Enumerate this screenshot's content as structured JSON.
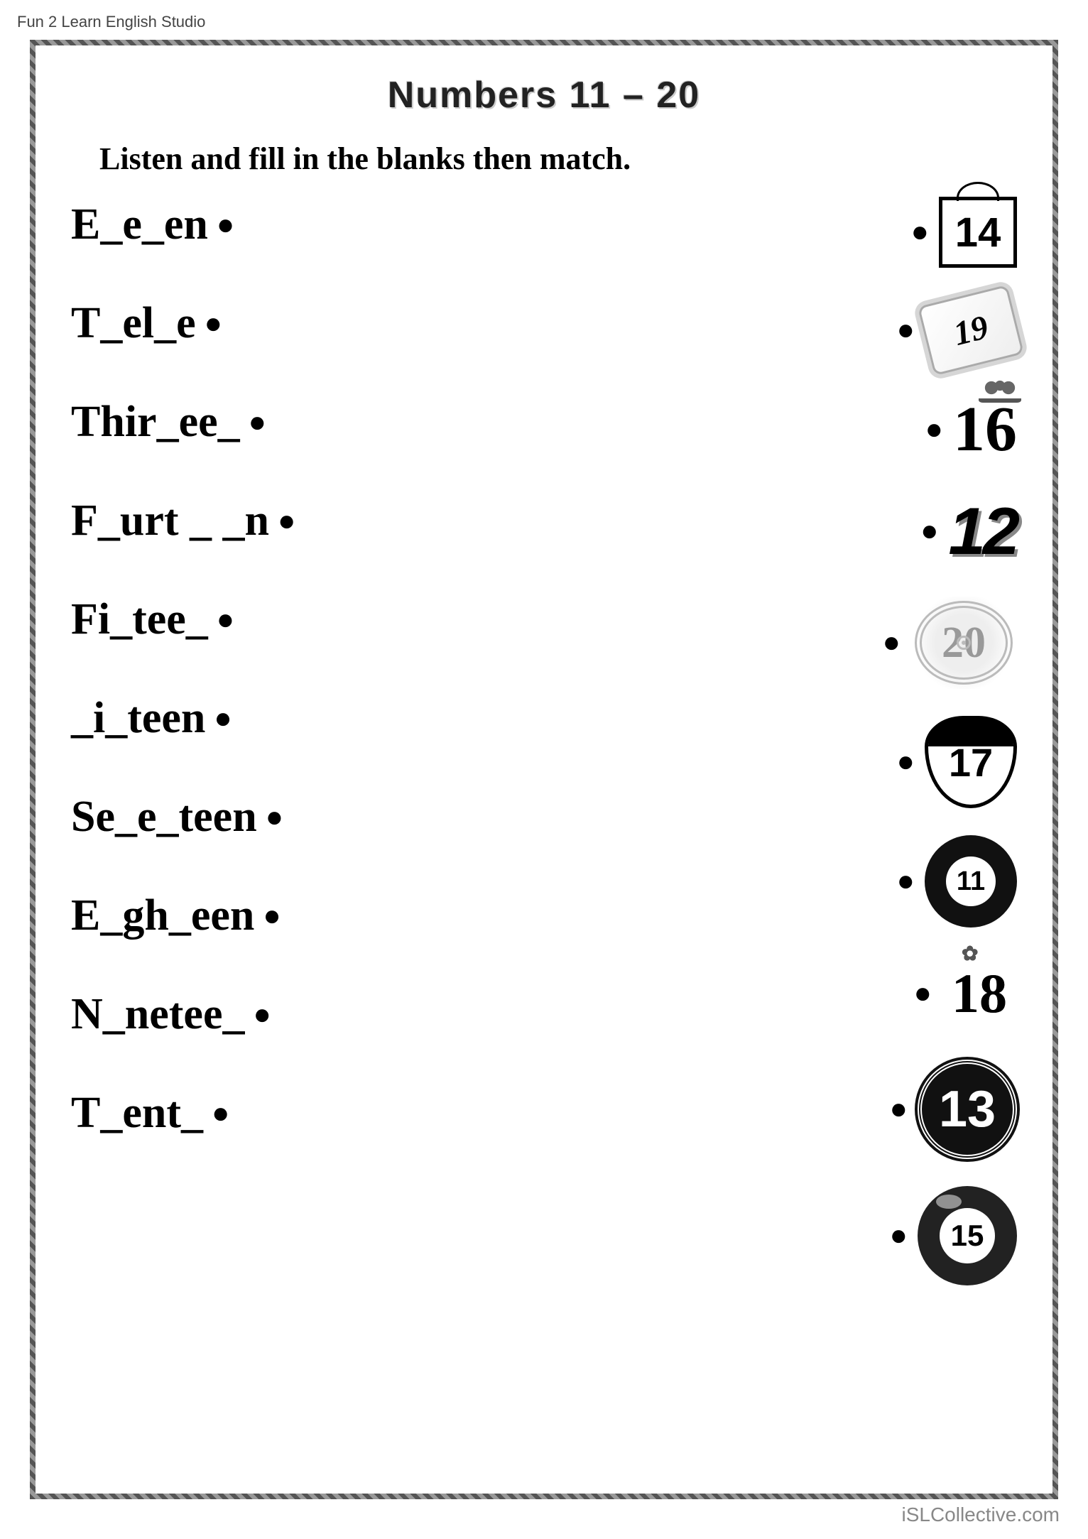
{
  "header_note": "Fun 2 Learn English Studio",
  "title": "Numbers  11 – 20",
  "instruction": "Listen and fill in the blanks then match.",
  "words": [
    "E_e_en",
    "T_el_e",
    "Thir_ee_",
    "F_urt _ _n",
    "Fi_tee_",
    "_i_teen",
    "Se_e_teen",
    "E_gh_een",
    "N_netee_",
    "T_ent_"
  ],
  "numbers": [
    "14",
    "19",
    "16",
    "12",
    "20",
    "17",
    "11",
    "18",
    "13",
    "15"
  ],
  "watermark": "iSLCollective.com"
}
